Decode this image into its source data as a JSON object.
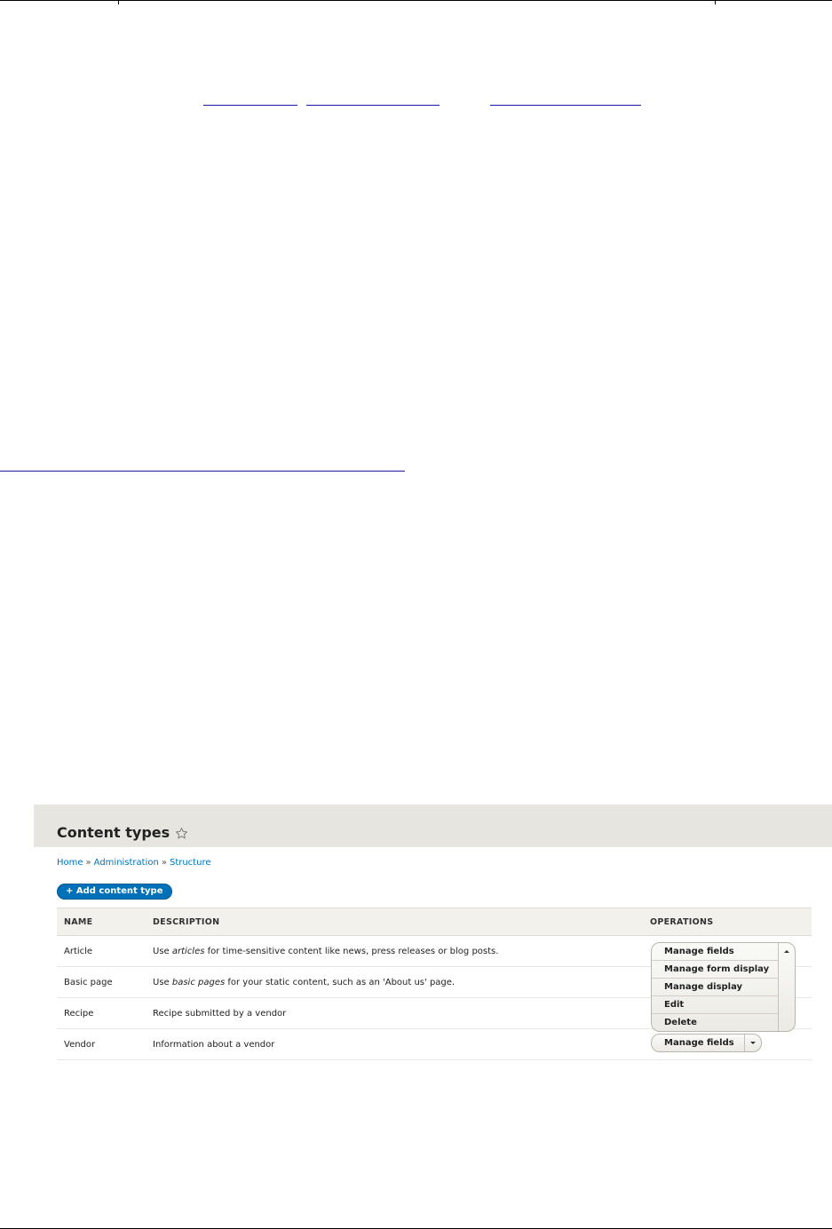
{
  "page": {
    "title": "Content types"
  },
  "breadcrumb": {
    "items": [
      "Home",
      "Administration",
      "Structure"
    ],
    "separator": "»"
  },
  "toolbar": {
    "add_label": "+ Add content type"
  },
  "table": {
    "headers": [
      "NAME",
      "DESCRIPTION",
      "OPERATIONS"
    ],
    "rows": [
      {
        "name": "Article",
        "description_pre": "Use ",
        "description_em": "articles",
        "description_post": " for time-sensitive content like news, press releases or blog posts."
      },
      {
        "name": "Basic page",
        "description_pre": "Use ",
        "description_em": "basic pages",
        "description_post": " for your static content, such as an 'About us' page."
      },
      {
        "name": "Recipe",
        "description_pre": "Recipe submitted by a vendor",
        "description_em": "",
        "description_post": ""
      },
      {
        "name": "Vendor",
        "description_pre": "Information about a vendor",
        "description_em": "",
        "description_post": ""
      }
    ]
  },
  "operations_open": {
    "items": [
      "Manage fields",
      "Manage form display",
      "Manage display",
      "Edit",
      "Delete"
    ],
    "toggle_icon": "caret-up-icon"
  },
  "operations_vendor": {
    "label": "Manage fields",
    "toggle_icon": "caret-down-icon"
  },
  "colors": {
    "primary_button": "#0071b8",
    "link": "#0074bd",
    "header_band": "#e6e5e0"
  }
}
